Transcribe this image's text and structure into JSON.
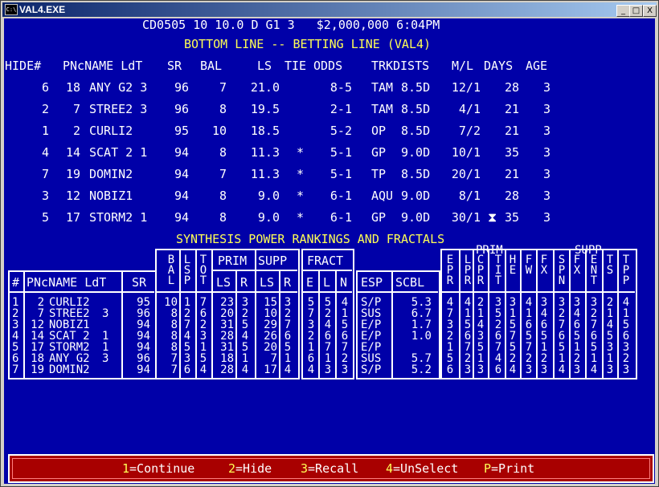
{
  "window": {
    "title": "VAL4.EXE",
    "icon_text": "C:\\",
    "buttons": [
      "_",
      "□",
      "X"
    ]
  },
  "header": {
    "race_line": "CD0505 10 10.0 D G1 3   $2,000,000 6:04PM",
    "title": "BOTTOM LINE -- BETTING LINE (VAL4)"
  },
  "betting_table": {
    "headers": [
      "HIDE#",
      "PNcNAME LdT",
      "SR",
      "BAL",
      "LS",
      "TIE",
      "ODDS",
      "TRK",
      "DISTS",
      "M/L",
      "DAYS",
      "AGE"
    ],
    "rows": [
      {
        "hide": "6",
        "pn": "18",
        "name": "ANY G2 3",
        "sr": "96",
        "bal": "7",
        "ls": "21.0",
        "tie": "",
        "odds": "8-5",
        "trk": "TAM",
        "dist": "8.5D",
        "ml": "12/1",
        "days": "28",
        "age": "3"
      },
      {
        "hide": "2",
        "pn": "7",
        "name": "STREE2 3",
        "sr": "96",
        "bal": "8",
        "ls": "19.5",
        "tie": "",
        "odds": "2-1",
        "trk": "TAM",
        "dist": "8.5D",
        "ml": "4/1",
        "days": "21",
        "age": "3"
      },
      {
        "hide": "1",
        "pn": "2",
        "name": "CURLI2",
        "sr": "95",
        "bal": "10",
        "ls": "18.5",
        "tie": "",
        "odds": "5-2",
        "trk": "OP",
        "dist": "8.5D",
        "ml": "7/2",
        "days": "21",
        "age": "3"
      },
      {
        "hide": "4",
        "pn": "14",
        "name": "SCAT 2 1",
        "sr": "94",
        "bal": "8",
        "ls": "11.3",
        "tie": "*",
        "odds": "5-1",
        "trk": "GP",
        "dist": "9.0D",
        "ml": "10/1",
        "days": "35",
        "age": "3"
      },
      {
        "hide": "7",
        "pn": "19",
        "name": "DOMIN2",
        "sr": "94",
        "bal": "7",
        "ls": "11.3",
        "tie": "*",
        "odds": "5-1",
        "trk": "TP",
        "dist": "8.5D",
        "ml": "20/1",
        "days": "21",
        "age": "3"
      },
      {
        "hide": "3",
        "pn": "12",
        "name": "NOBIZ1",
        "sr": "94",
        "bal": "8",
        "ls": "9.0",
        "tie": "*",
        "odds": "6-1",
        "trk": "AQU",
        "dist": "9.0D",
        "ml": "8/1",
        "days": "28",
        "age": "3"
      },
      {
        "hide": "5",
        "pn": "17",
        "name": "STORM2 1",
        "sr": "94",
        "bal": "8",
        "ls": "9.0",
        "tie": "*",
        "odds": "6-1",
        "trk": "GP",
        "dist": "9.0D",
        "ml": "30/1",
        "days": "35",
        "age": "3"
      }
    ]
  },
  "synthesis": {
    "title": "SYNTHESIS POWER RANKINGS AND FRACTALS",
    "labels": {
      "num": "#",
      "pnc": "PNcNAME LdT",
      "sr": "SR",
      "bal": "BAL",
      "lsp": "LSP",
      "tot": "TOT",
      "prim": "PRIM",
      "supp": "SUPP",
      "ls": "LS",
      "r": "R",
      "fract": "FRACT",
      "e": "E",
      "l": "L",
      "n": "N",
      "esp": "ESP",
      "scbl": "SCBL",
      "right_prim": "PRIM",
      "right_supp": "SUPP",
      "right_cols": [
        "EPR",
        "LPR",
        "CPR",
        "TIT",
        "HE",
        "FW",
        "FX",
        "SPN",
        "FX",
        "ENT",
        "TS",
        "TPP"
      ]
    },
    "rows": [
      {
        "num": "1",
        "pn": "2",
        "name": "CURLI2",
        "ldt": "",
        "sr": "95",
        "bal": "10",
        "lsp": "1",
        "tot": "7",
        "pls": "23",
        "pr": "3",
        "sls": "15",
        "sr2": "3",
        "e": "5",
        "l": "5",
        "n": "4",
        "esp": "S/P",
        "scbl": "5.3",
        "r": [
          "4",
          "4",
          "2",
          "3",
          "3",
          "4",
          "3",
          "3",
          "3",
          "3",
          "2",
          "4"
        ]
      },
      {
        "num": "2",
        "pn": "7",
        "name": "STREE2",
        "ldt": "3",
        "sr": "96",
        "bal": "8",
        "lsp": "2",
        "tot": "6",
        "pls": "20",
        "pr": "2",
        "sls": "10",
        "sr2": "2",
        "e": "7",
        "l": "2",
        "n": "1",
        "esp": "SUS",
        "scbl": "6.7",
        "r": [
          "7",
          "1",
          "1",
          "5",
          "1",
          "1",
          "4",
          "2",
          "4",
          "2",
          "1",
          "1"
        ]
      },
      {
        "num": "3",
        "pn": "12",
        "name": "NOBIZ1",
        "ldt": "",
        "sr": "94",
        "bal": "8",
        "lsp": "7",
        "tot": "2",
        "pls": "31",
        "pr": "5",
        "sls": "29",
        "sr2": "7",
        "e": "3",
        "l": "4",
        "n": "5",
        "esp": "E/P",
        "scbl": "1.7",
        "r": [
          "3",
          "5",
          "4",
          "2",
          "5",
          "6",
          "6",
          "7",
          "6",
          "7",
          "4",
          "5"
        ]
      },
      {
        "num": "4",
        "pn": "14",
        "name": "SCAT 2",
        "ldt": "1",
        "sr": "94",
        "bal": "8",
        "lsp": "4",
        "tot": "3",
        "pls": "28",
        "pr": "4",
        "sls": "26",
        "sr2": "6",
        "e": "2",
        "l": "6",
        "n": "6",
        "esp": "E/P",
        "scbl": "1.0",
        "r": [
          "2",
          "6",
          "3",
          "6",
          "7",
          "5",
          "5",
          "6",
          "5",
          "6",
          "5",
          "6"
        ]
      },
      {
        "num": "5",
        "pn": "17",
        "name": "STORM2",
        "ldt": "1",
        "sr": "94",
        "bal": "8",
        "lsp": "5",
        "tot": "1",
        "pls": "31",
        "pr": "5",
        "sls": "20",
        "sr2": "5",
        "e": "1",
        "l": "7",
        "n": "7",
        "esp": "E/P",
        "scbl": "",
        "r": [
          "1",
          "7",
          "5",
          "7",
          "5",
          "7",
          "1",
          "5",
          "1",
          "5",
          "3",
          "3"
        ]
      },
      {
        "num": "6",
        "pn": "18",
        "name": "ANY G2",
        "ldt": "3",
        "sr": "96",
        "bal": "7",
        "lsp": "3",
        "tot": "5",
        "pls": "18",
        "pr": "1",
        "sls": "7",
        "sr2": "1",
        "e": "6",
        "l": "1",
        "n": "2",
        "esp": "SUS",
        "scbl": "5.7",
        "r": [
          "5",
          "2",
          "1",
          "4",
          "2",
          "2",
          "2",
          "1",
          "2",
          "1",
          "1",
          "2"
        ]
      },
      {
        "num": "7",
        "pn": "19",
        "name": "DOMIN2",
        "ldt": "",
        "sr": "94",
        "bal": "7",
        "lsp": "6",
        "tot": "4",
        "pls": "28",
        "pr": "4",
        "sls": "17",
        "sr2": "4",
        "e": "4",
        "l": "3",
        "n": "3",
        "esp": "S/P",
        "scbl": "5.2",
        "r": [
          "6",
          "3",
          "3",
          "6",
          "4",
          "3",
          "3",
          "4",
          "3",
          "4",
          "3",
          "3"
        ]
      }
    ]
  },
  "footer": {
    "keys": [
      {
        "key": "1",
        "label": "=Continue"
      },
      {
        "key": "2",
        "label": "=Hide"
      },
      {
        "key": "3",
        "label": "=Recall"
      },
      {
        "key": "4",
        "label": "=UnSelect"
      },
      {
        "key": "P",
        "label": "=Print"
      }
    ]
  },
  "colors": {
    "background": "#0000a8",
    "text": "#ffffff",
    "title": "#ffff55",
    "rank1": "#ff5555",
    "rank2": "#55ff55",
    "rank3": "#ffff55",
    "footer": "#a80000"
  }
}
